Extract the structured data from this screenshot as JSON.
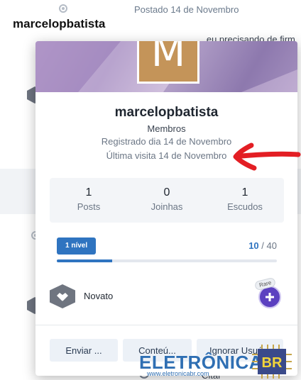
{
  "background": {
    "username": "marcelopbatista",
    "post_date": "Postado 14 de Novembro",
    "post_snippet": "...eu precisando de firm",
    "bottom_text": "Citar"
  },
  "card": {
    "avatar_letter": "M",
    "name": "marcelopbatista",
    "group": "Membros",
    "registered": "Registrado dia 14 de Novembro",
    "last_visit": "Última visita 14 de Novembro",
    "stats": [
      {
        "value": "1",
        "label": "Posts"
      },
      {
        "value": "0",
        "label": "Joinhas"
      },
      {
        "value": "1",
        "label": "Escudos"
      }
    ],
    "level_label": "1 nível",
    "points_current": "10",
    "points_separator": "/",
    "points_total": "40",
    "progress_fraction": 0.25,
    "rank_name": "Novato",
    "rare_label": "Rare",
    "buttons": {
      "send": "Enviar ...",
      "content": "Conteú...",
      "ignore": "Ignorar Usuá..."
    }
  },
  "watermark": {
    "brand_text": "ELETRÔNICA",
    "brand_br": "BR",
    "url": "www.eletronicabr.com"
  },
  "colors": {
    "accent": "#2f74c0",
    "avatar_bg": "#c49459",
    "rare_purple": "#5b40c0",
    "annotation_red": "#e31e24"
  }
}
